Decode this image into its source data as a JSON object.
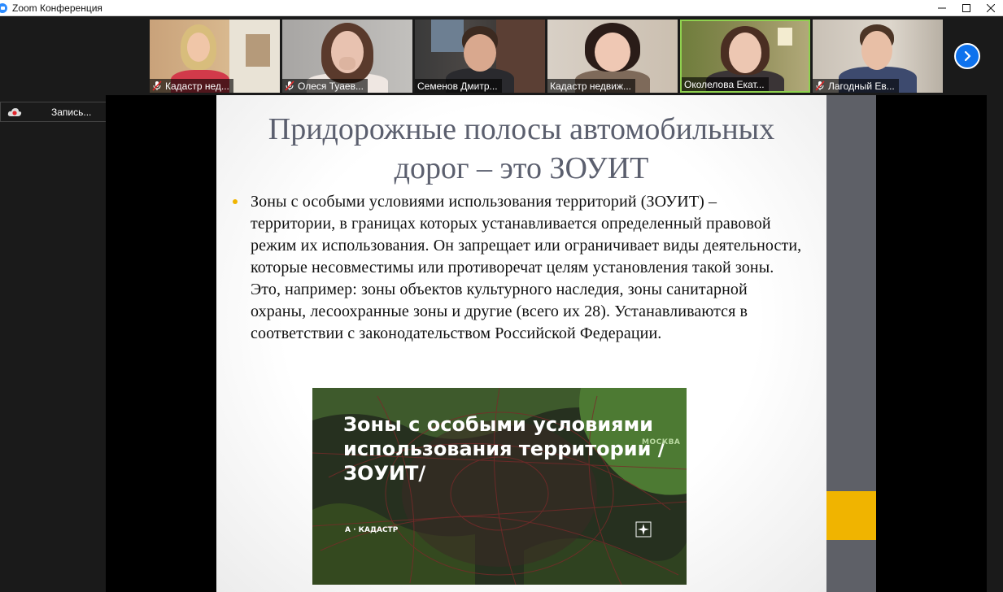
{
  "window": {
    "title": "Zoom Конференция"
  },
  "participants": [
    {
      "name": "Кадастр нед...",
      "muted": true
    },
    {
      "name": "Олеся Туаев...",
      "muted": true
    },
    {
      "name": "Семенов Дмитр...",
      "muted": false
    },
    {
      "name": "Кадастр недвиж...",
      "muted": false
    },
    {
      "name": "Околелова Екат...",
      "muted": false,
      "active_speaker": true
    },
    {
      "name": "Лагодный Ев...",
      "muted": true
    }
  ],
  "recording": {
    "label": "Запись..."
  },
  "slide": {
    "title": "Придорожные полосы автомобильных дорог – это ЗОУИТ",
    "bullet": "Зоны с особыми условиями использования территорий (ЗОУИТ) – территории, в границах которых устанавливается определенный правовой режим их использования. Он запрещает или ограничивает виды деятельности, которые несовместимы или противоречат целям установления такой зоны. Это, например: зоны объектов культурного наследия, зоны санитарной охраны, лесоохранные зоны и другие (всего их 28). Устанавливаются в соответствии с законодательством Российской Федерации.",
    "image": {
      "title": "Зоны с особыми условиями использования территории / ЗОУИТ/",
      "city_label": "МОСКВА",
      "brand": "А · КАДАСТР"
    }
  },
  "colors": {
    "accent": "#f0b400",
    "next_button": "#0e72ed",
    "active_border": "#8fd14f",
    "slide_title": "#5b5f6e"
  }
}
